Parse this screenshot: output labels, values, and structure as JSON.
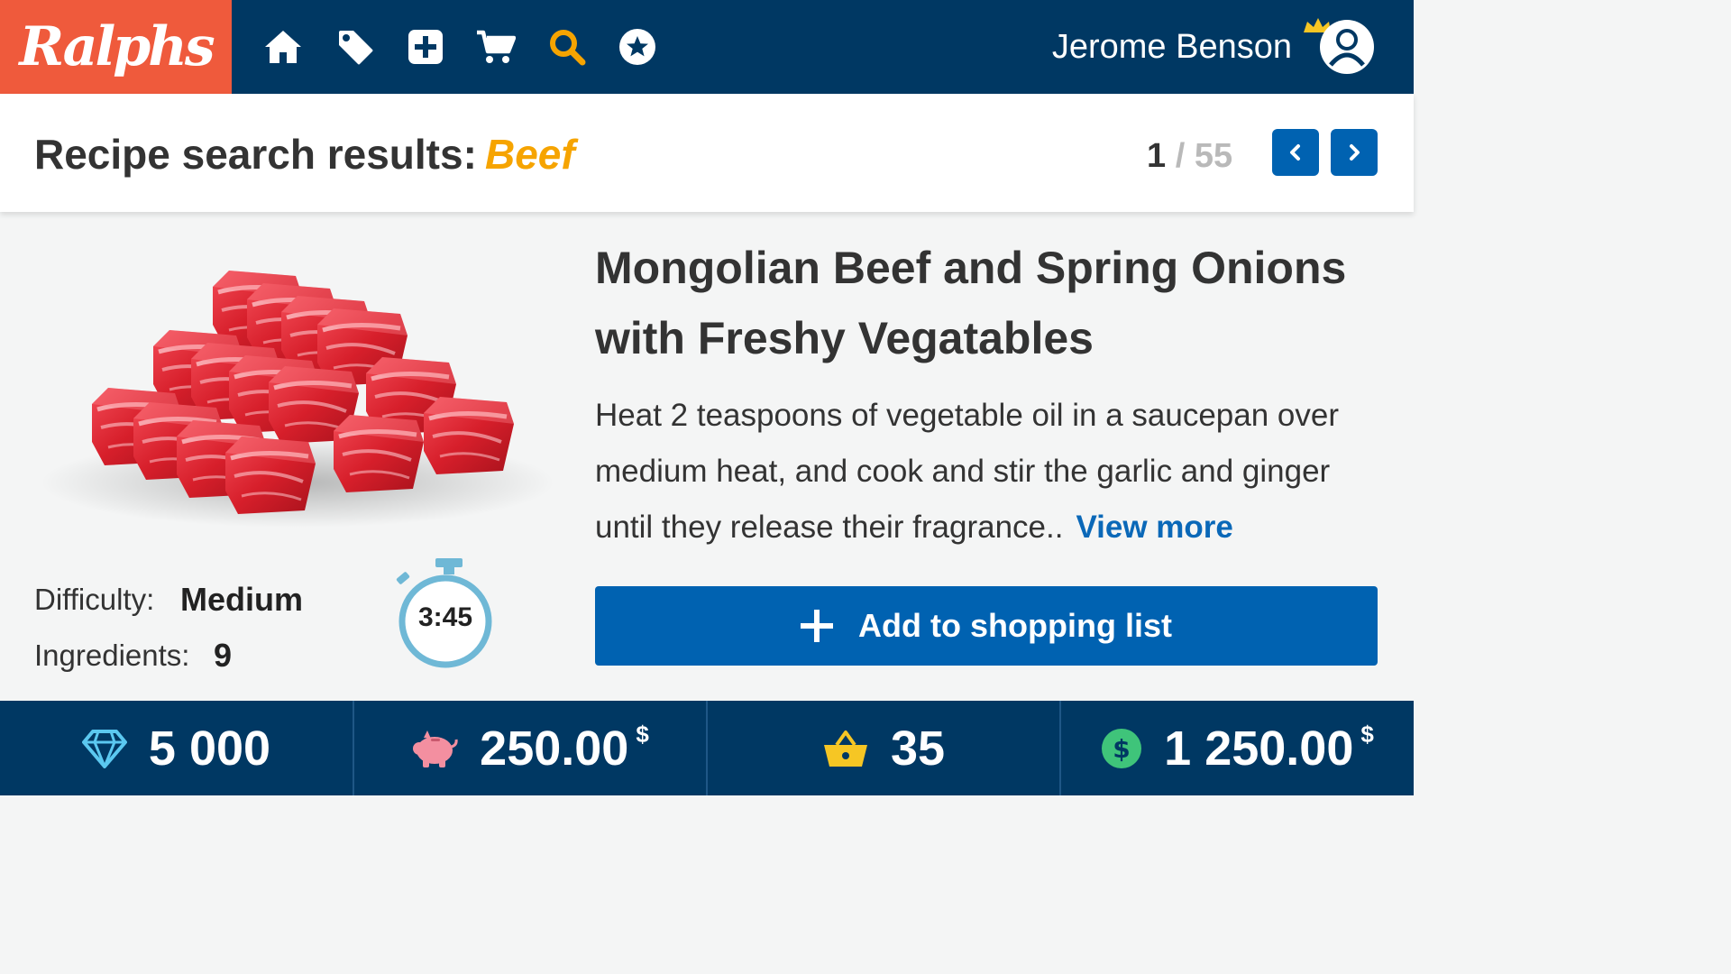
{
  "brand": {
    "logo_text": "Ralphs",
    "accent": "#ef5a3c",
    "navy": "#003863",
    "blue": "#0062b1",
    "yellow": "#f6a400"
  },
  "nav": {
    "icons": [
      "home-icon",
      "tag-icon",
      "add-icon",
      "cart-icon",
      "search-icon",
      "star-icon"
    ],
    "active": "search-icon"
  },
  "user": {
    "name": "Jerome Benson"
  },
  "search": {
    "label": "Recipe search results:",
    "term": "Beef",
    "page_current": "1",
    "page_separator": "/",
    "page_total": "55"
  },
  "recipe": {
    "title": "Mongolian Beef and Spring Onions with Freshy Vegatables",
    "description": "Heat 2 teaspoons of vegetable oil in a saucepan over medium heat, and cook and stir the garlic and ginger until they release their fragrance..",
    "view_more": "View more",
    "difficulty_label": "Difficulty:",
    "difficulty_value": "Medium",
    "ingredients_label": "Ingredients:",
    "ingredients_value": "9",
    "time": "3:45",
    "add_button": "Add to shopping list"
  },
  "stats": [
    {
      "icon": "diamond-icon",
      "value": "5 000",
      "unit": ""
    },
    {
      "icon": "piggy-bank-icon",
      "value": "250.00",
      "unit": "$"
    },
    {
      "icon": "basket-icon",
      "value": "35",
      "unit": ""
    },
    {
      "icon": "dollar-coin-icon",
      "value": "1 250.00",
      "unit": "$"
    }
  ]
}
